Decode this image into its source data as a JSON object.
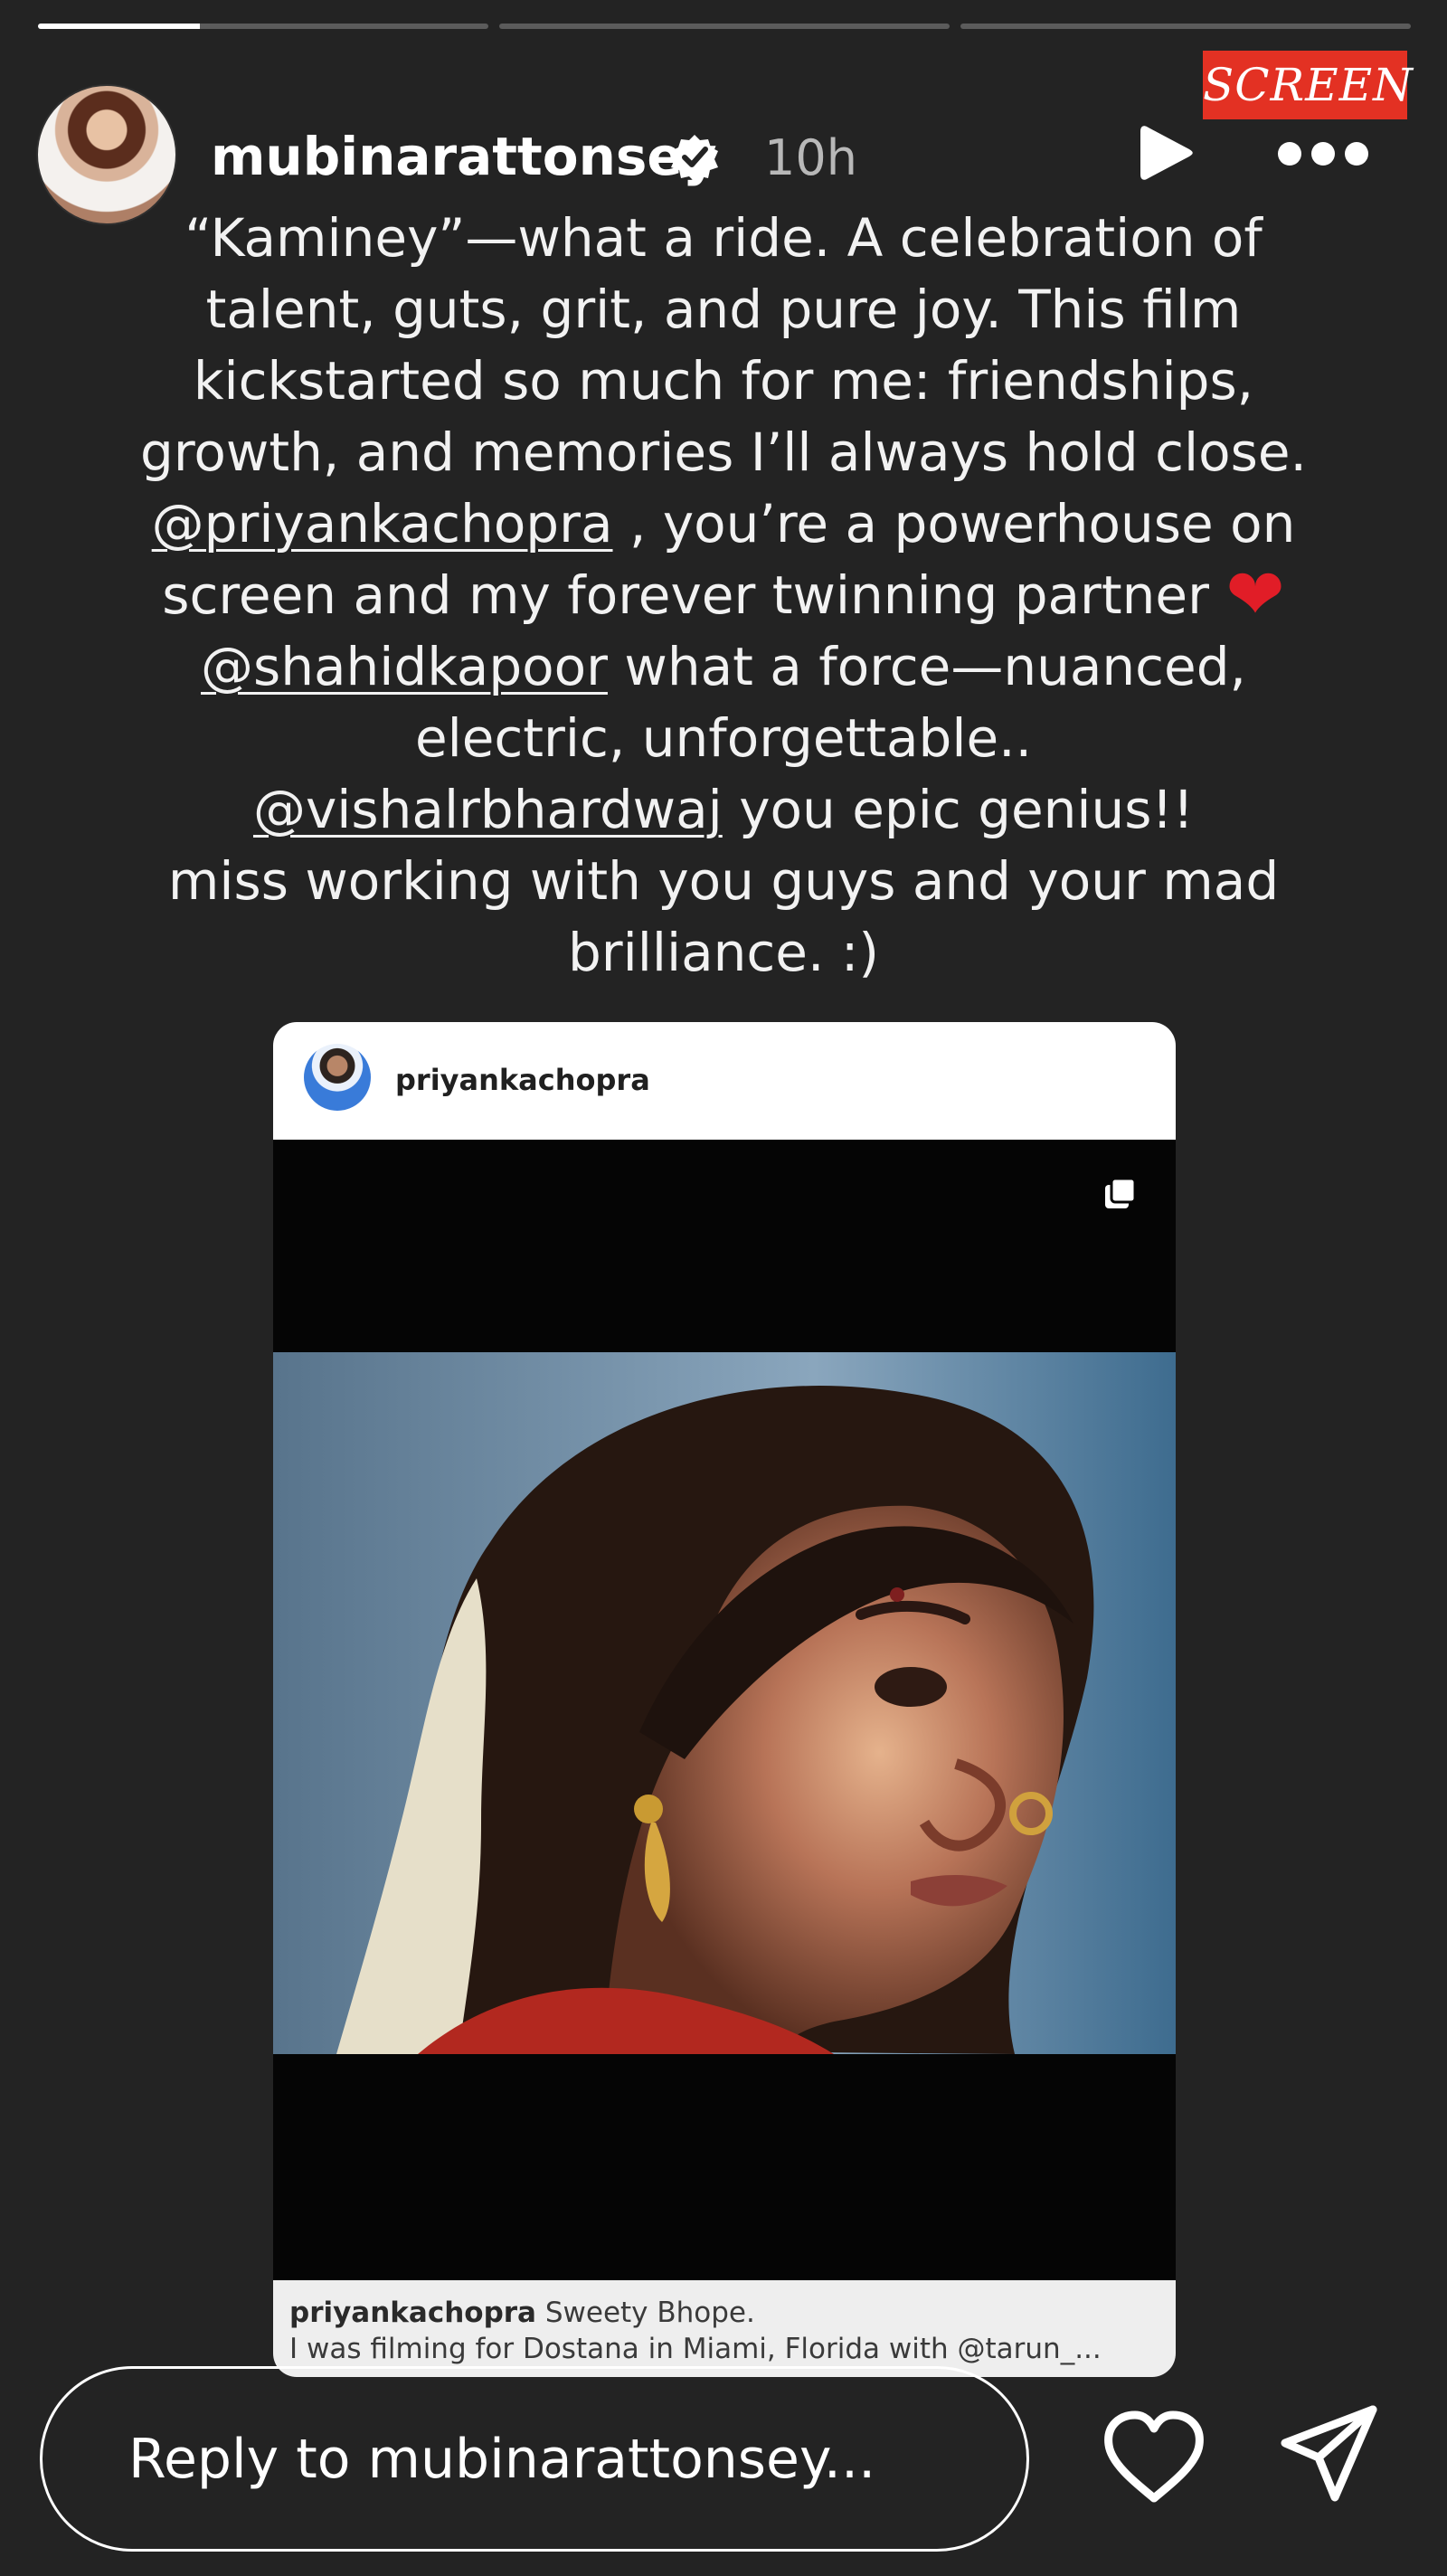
{
  "story": {
    "progress": [
      1,
      0,
      0
    ],
    "progress_fill": [
      0.36,
      0,
      0
    ]
  },
  "header": {
    "username": "mubinarattonsey",
    "time": "10h",
    "verified": true,
    "watermark": "SCREEN"
  },
  "caption": {
    "lines": [
      "“Kaminey”—what a ride. A celebration of",
      "talent, guts, grit, and pure joy. This film",
      "kickstarted so much for me: friendships,",
      "growth, and memories I’ll always hold close.",
      "@priyankachopra",
      " , you’re a powerhouse on",
      "screen and my forever twinning partner ",
      "❤",
      "@shahidkapoor",
      " what a force—nuanced,",
      "electric, unforgettable..",
      "@vishalrbhardwaj",
      "  you epic genius!!",
      "miss working with you guys and your mad",
      "brilliance. :)"
    ]
  },
  "shared_post": {
    "username": "priyankachopra",
    "caption_user": "priyankachopra",
    "caption_text": " Sweety Bhope.",
    "caption_line2": "I was filming for Dostana in Miami, Florida with @tarun_...",
    "carousel_icon": "carousel-icon"
  },
  "footer": {
    "reply_placeholder": "Reply to mubinarattonsey...",
    "like_icon": "heart-icon",
    "share_icon": "send-icon"
  },
  "colors": {
    "background": "#232323",
    "accent_red": "#e33123",
    "heart": "#e11d27"
  }
}
